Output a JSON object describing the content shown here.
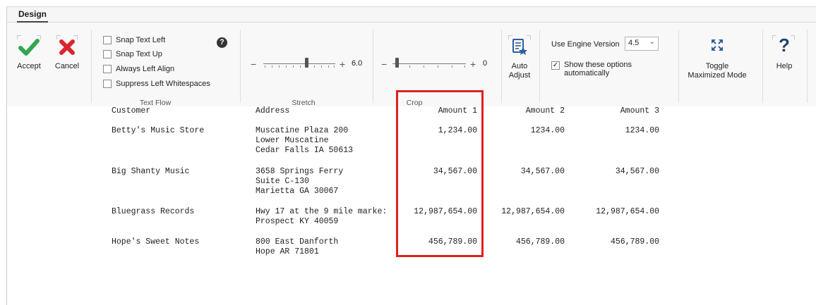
{
  "ribbon": {
    "tab": "Design",
    "accept_label": "Accept",
    "cancel_label": "Cancel",
    "text_flow": {
      "group_label": "Text Flow",
      "options": [
        {
          "label": "Snap Text Left",
          "checked": false
        },
        {
          "label": "Snap Text Up",
          "checked": false
        },
        {
          "label": "Always Left Align",
          "checked": false
        },
        {
          "label": "Suppress Left Whitespaces",
          "checked": false
        }
      ],
      "help_glyph": "?"
    },
    "stretch": {
      "group_label": "Stretch",
      "minus": "−",
      "plus": "+",
      "value": "6.0",
      "level": 0.55
    },
    "crop": {
      "group_label": "Crop",
      "minus": "−",
      "plus": "+",
      "value": "0",
      "level": 0.0
    },
    "auto_adjust": {
      "line1": "Auto",
      "line2": "Adjust"
    },
    "engine": {
      "label": "Use Engine Version",
      "selected": "4.5",
      "show_options_line1": "Show these options",
      "show_options_line2": "automatically",
      "show_options_checked": true
    },
    "toggle": {
      "line1": "Toggle",
      "line2": "Maximized Mode"
    },
    "help": {
      "label": "Help"
    }
  },
  "report": {
    "headers": [
      "Customer",
      "Address",
      "Amount 1",
      "Amount 2",
      "Amount 3"
    ],
    "rows": [
      {
        "customer": "Betty's Music Store",
        "address": [
          "Muscatine Plaza 200",
          "Lower Muscatine",
          "Cedar Falls IA 50613"
        ],
        "amount1": "1,234.00",
        "amount2": "1234.00",
        "amount3": "1234.00"
      },
      {
        "customer": "Big Shanty Music",
        "address": [
          "3658 Springs Ferry",
          "Suite C-130",
          "Marietta GA 30067"
        ],
        "amount1": "34,567.00",
        "amount2": "34,567.00",
        "amount3": "34,567.00"
      },
      {
        "customer": "Bluegrass Records",
        "address": [
          "Hwy 17 at the 9 mile marke:",
          "Prospect KY 40059"
        ],
        "amount1": "12,987,654.00",
        "amount2": "12,987,654.00",
        "amount3": "12,987,654.00"
      },
      {
        "customer": "Hope's Sweet Notes",
        "address": [
          "800 East Danforth",
          "Hope AR 71801"
        ],
        "amount1": "456,789.00",
        "amount2": "456,789.00",
        "amount3": "456,789.00"
      }
    ]
  },
  "colors": {
    "accept": "#2fa84f",
    "cancel": "#d9262c",
    "highlight": "#e02020",
    "auto_adjust_icon": "#2f5f9e"
  }
}
